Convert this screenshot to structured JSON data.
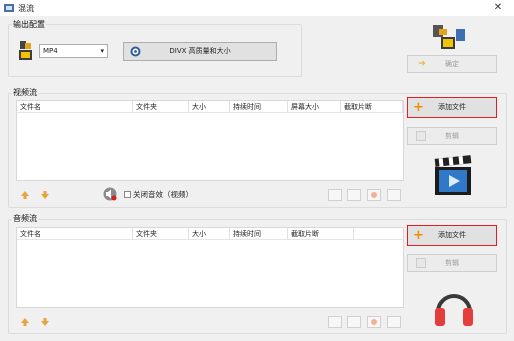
{
  "window": {
    "title": "混流"
  },
  "output": {
    "group_label": "输出配置",
    "format_value": "MP4",
    "codec_button_label": "DIVX 高质量和大小",
    "confirm_label": "确定"
  },
  "video": {
    "group_label": "视频流",
    "columns": [
      "文件名",
      "文件夹",
      "大小",
      "持续时间",
      "屏幕大小",
      "截取片断"
    ],
    "add_file_label": "添加文件",
    "clip_label": "剪辑",
    "mute_label": "关闭音效（视频）"
  },
  "audio": {
    "group_label": "音频流",
    "columns": [
      "文件名",
      "文件夹",
      "大小",
      "持续时间",
      "截取片断"
    ],
    "add_file_label": "添加文件",
    "clip_label": "剪辑"
  }
}
